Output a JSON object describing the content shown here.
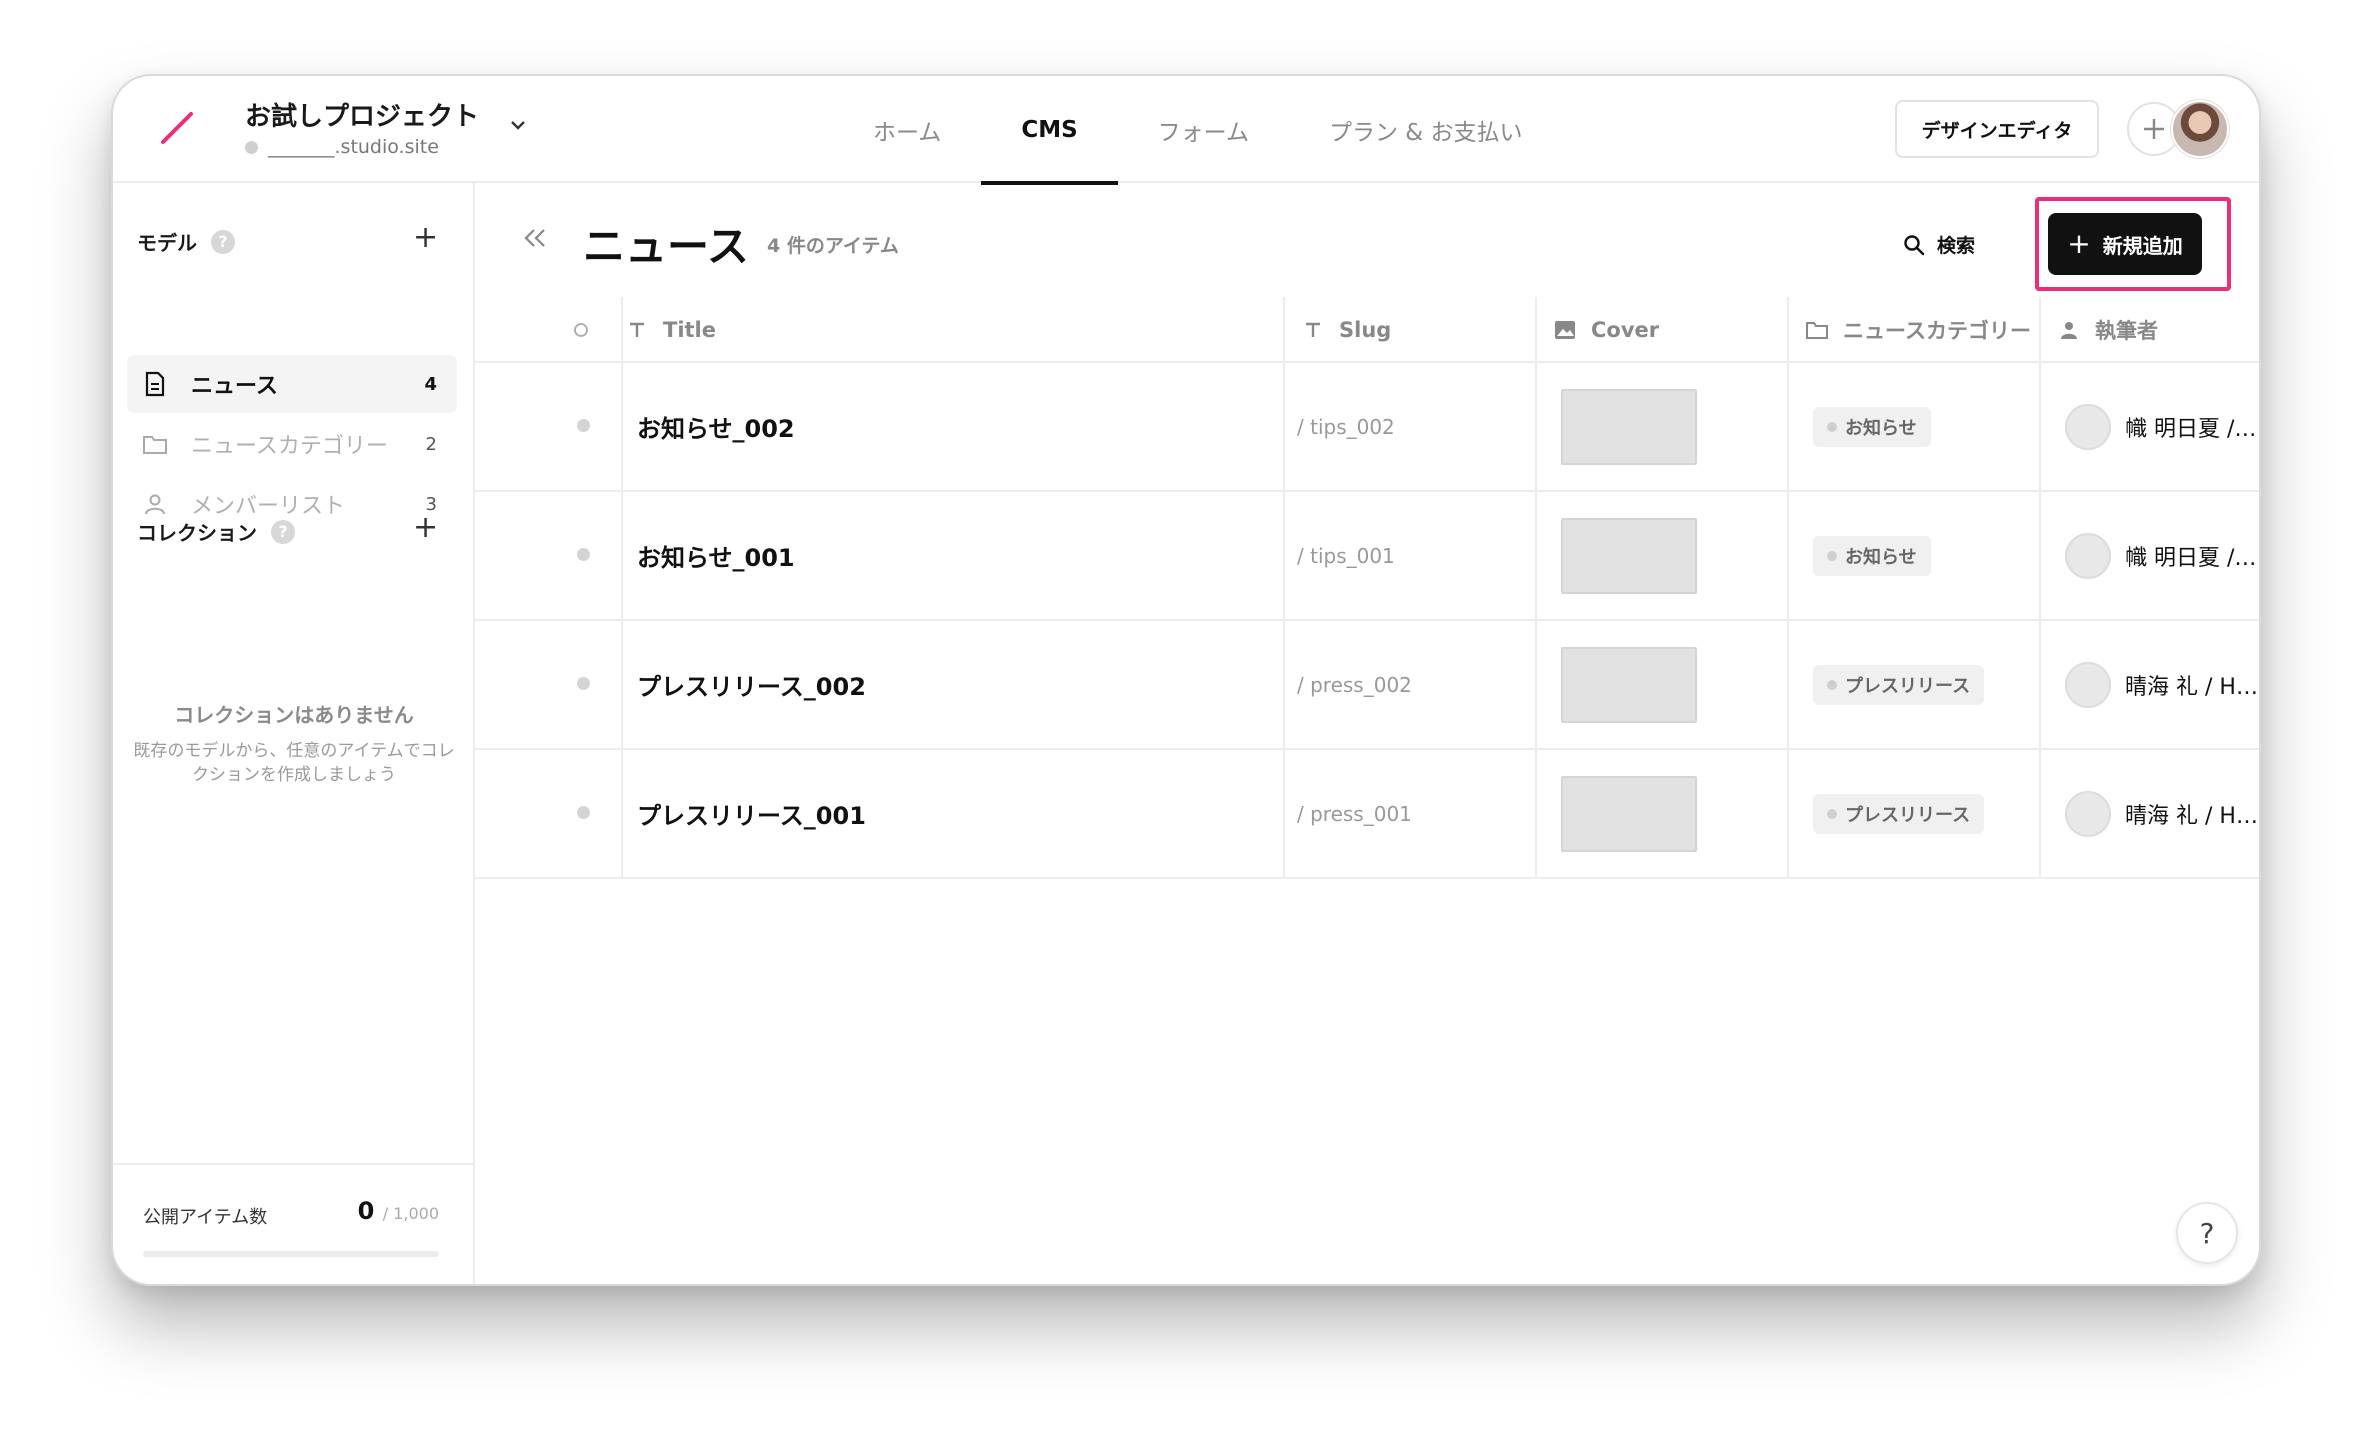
{
  "project": {
    "name": "お試しプロジェクト",
    "domain": "_______.studio.site"
  },
  "nav": {
    "items": [
      {
        "label": "ホーム",
        "active": false
      },
      {
        "label": "CMS",
        "active": true
      },
      {
        "label": "フォーム",
        "active": false
      },
      {
        "label": "プラン & お支払い",
        "active": false
      }
    ]
  },
  "header": {
    "design_editor_label": "デザインエディタ"
  },
  "sidebar": {
    "models_heading": "モデル",
    "models": [
      {
        "label": "ニュース",
        "count": "4",
        "icon": "document-icon",
        "active": true
      },
      {
        "label": "ニュースカテゴリー",
        "count": "2",
        "icon": "folder-icon",
        "active": false
      },
      {
        "label": "メンバーリスト",
        "count": "3",
        "icon": "person-icon",
        "active": false
      }
    ],
    "collections_heading": "コレクション",
    "collections_empty_title": "コレクションはありません",
    "collections_empty_desc": "既存のモデルから、任意のアイテムでコレクションを作成しましょう",
    "published_label": "公開アイテム数",
    "published_value": "0",
    "published_max": "/ 1,000",
    "published_fraction": 0
  },
  "main": {
    "title": "ニュース",
    "item_count": "4 件のアイテム",
    "search_label": "検索",
    "new_button_label": "新規追加",
    "columns": {
      "title": "Title",
      "slug": "Slug",
      "cover": "Cover",
      "category": "ニュースカテゴリー",
      "author": "執筆者"
    },
    "rows": [
      {
        "title": "お知らせ_002",
        "slug": "/ tips_002",
        "category": "お知らせ",
        "author": "幟 明日夏 / Asuka Nobori"
      },
      {
        "title": "お知らせ_001",
        "slug": "/ tips_001",
        "category": "お知らせ",
        "author": "幟 明日夏 / Asuka Nobori"
      },
      {
        "title": "プレスリリース_002",
        "slug": "/ press_002",
        "category": "プレスリリース",
        "author": "晴海 礼 / Hiroshi Harumi"
      },
      {
        "title": "プレスリリース_001",
        "slug": "/ press_001",
        "category": "プレスリリース",
        "author": "晴海 礼 / Hiroshi Harumi"
      }
    ]
  },
  "help_label": "?",
  "colors": {
    "accent_pink": "#ec2d7a",
    "primary_black": "#111111"
  }
}
